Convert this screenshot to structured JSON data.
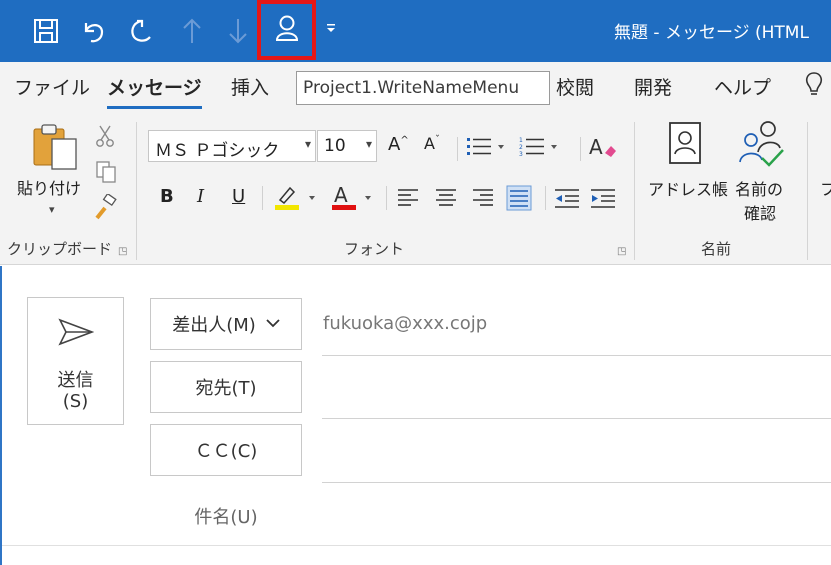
{
  "window_title": "無題 - メッセージ (HTML",
  "qat": {
    "save_icon": "save-icon",
    "undo_icon": "undo-icon",
    "redo_icon": "redo-icon",
    "up_icon": "arrow-up-icon",
    "down_icon": "arrow-down-icon",
    "macro_icon": "person-icon",
    "customize": "customize-dropdown-icon"
  },
  "tabs": [
    {
      "label": "ファイル",
      "active": false
    },
    {
      "label": "メッセージ",
      "active": true
    },
    {
      "label": "挿入",
      "active": false
    },
    {
      "label": "校閲",
      "active": false
    },
    {
      "label": "開発",
      "active": false
    },
    {
      "label": "ヘルプ",
      "active": false
    }
  ],
  "tooltip": "Project1.WriteNameMenu",
  "ribbon": {
    "clipboard": {
      "paste_label": "貼り付け",
      "group_label": "クリップボード"
    },
    "font": {
      "font_name": "ＭＳ Ｐゴシック",
      "font_size": "10",
      "bold": "B",
      "italic": "I",
      "underline": "U",
      "font_color_letter": "A",
      "grow_font": "A",
      "shrink_font": "A",
      "group_label": "フォント",
      "highlight_color": "#f2e600",
      "font_color": "#e01010"
    },
    "names": {
      "address_book": "アドレス帳",
      "check_names_line1": "名前の",
      "check_names_line2": "確認",
      "group_label": "名前",
      "partial_next": "フ"
    }
  },
  "compose": {
    "send_line1": "送信",
    "send_line2": "(S)",
    "from_button": "差出人(M)",
    "from_value": "fukuoka@xxx.cojp",
    "to_button": "宛先(T)",
    "cc_button": "ＣＣ(C)",
    "subject_label": "件名(U)"
  },
  "colors": {
    "titlebar": "#1f6dc1",
    "highlight_border": "#e51717",
    "accent": "#1f6dc1"
  }
}
